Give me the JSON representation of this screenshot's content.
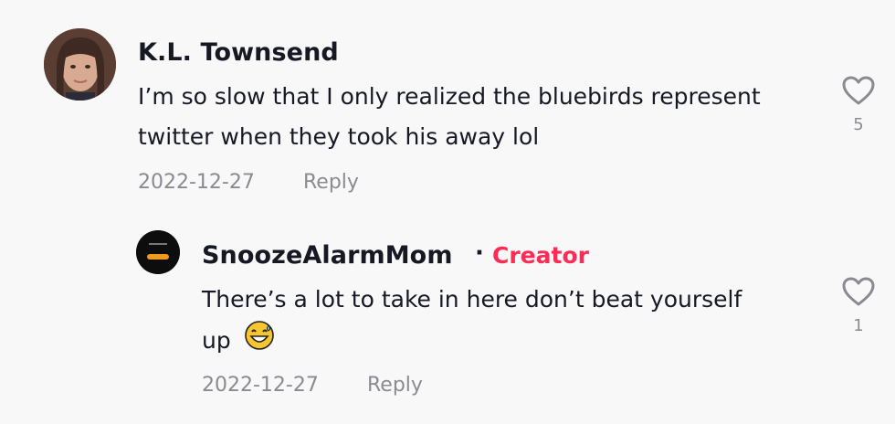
{
  "comment": {
    "username": "K.L. Townsend",
    "text_line1": "I’m so slow that I only realized the bluebirds represent",
    "text_line2": "twitter when they took his away lol",
    "date": "2022-12-27",
    "reply_label": "Reply",
    "like_icon": "heart-outline-icon",
    "like_count": "5"
  },
  "reply": {
    "username": "SnoozeAlarmMom",
    "separator": "·",
    "badge": "Creator",
    "badge_color": "#fe2c55",
    "text_line1": "There’s a lot to take in here don’t beat yourself",
    "text_line2": "up",
    "emoji_icon": "grinning-sweat-emoji-icon",
    "date": "2022-12-27",
    "reply_label": "Reply",
    "like_icon": "heart-outline-icon",
    "like_count": "1"
  }
}
